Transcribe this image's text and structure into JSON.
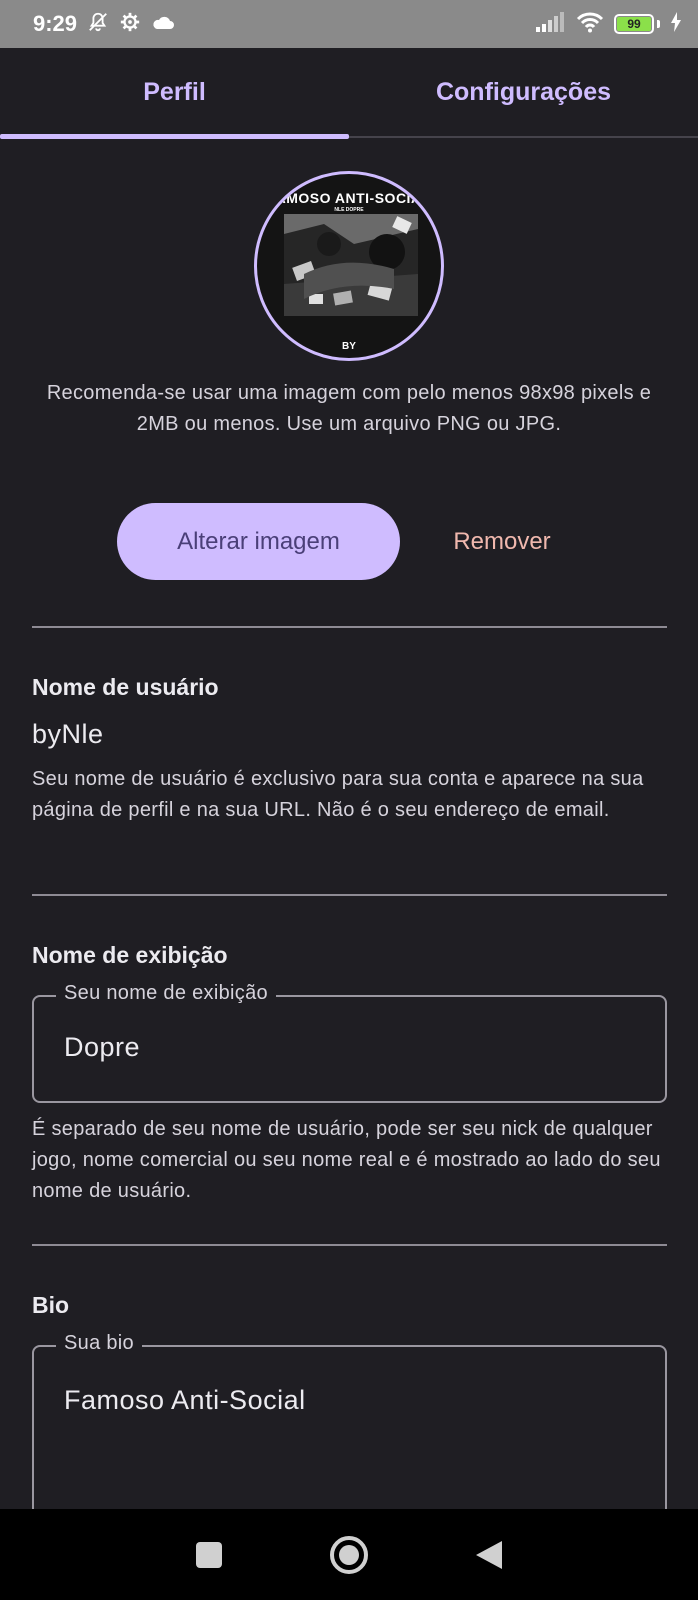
{
  "status_bar": {
    "time": "9:29",
    "battery": "99",
    "left_icons": [
      "mute-bell-icon",
      "settings-gear-icon",
      "cloud-icon"
    ],
    "right_icons": [
      "signal-icon",
      "wifi-icon",
      "battery-icon",
      "charging-icon"
    ]
  },
  "tabs": [
    {
      "label": "Perfil",
      "active": true
    },
    {
      "label": "Configurações",
      "active": false
    }
  ],
  "avatar": {
    "title": "FAMOSO ANTI-SOCIAL",
    "subtitle": "NLE DOPRE",
    "by": "BY"
  },
  "image_hint": "Recomenda-se usar uma imagem com pelo menos 98x98 pixels e 2MB ou menos. Use um arquivo PNG ou JPG.",
  "buttons": {
    "change_image": "Alterar imagem",
    "remove": "Remover"
  },
  "username": {
    "title": "Nome de usuário",
    "value": "byNle",
    "help": "Seu nome de usuário é exclusivo para sua conta e aparece na sua página de perfil e na sua URL. Não é o seu endereço de email."
  },
  "display_name": {
    "title": "Nome de exibição",
    "field_label": "Seu nome de exibição",
    "value": "Dopre",
    "help": "É separado de seu nome de usuário, pode ser seu nick de qualquer jogo, nome comercial ou seu nome real e é mostrado ao lado do seu nome de usuário."
  },
  "bio": {
    "title": "Bio",
    "field_label": "Sua bio",
    "value": "Famoso Anti-Social"
  },
  "colors": {
    "accent": "#cfbcff",
    "background": "#1f1e23",
    "remove": "#f0b8ae"
  }
}
